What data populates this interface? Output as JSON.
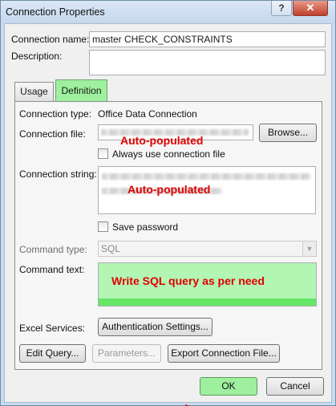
{
  "window": {
    "title": "Connection Properties",
    "help_glyph": "?",
    "close_glyph": "✕"
  },
  "connection": {
    "name_label": "Connection name:",
    "name_value": "master CHECK_CONSTRAINTS",
    "description_label": "Description:",
    "description_value": ""
  },
  "tabs": [
    {
      "label": "Usage",
      "selected": false
    },
    {
      "label": "Definition",
      "selected": true
    }
  ],
  "definition": {
    "connection_type_label": "Connection type:",
    "connection_type_value": "Office Data Connection",
    "connection_file_label": "Connection file:",
    "browse_label": "Browse...",
    "always_use_label": "Always use connection file",
    "connection_string_label": "Connection string:",
    "save_password_label": "Save password",
    "command_type_label": "Command type:",
    "command_type_value": "SQL",
    "command_text_label": "Command text:",
    "excel_services_label": "Excel Services:",
    "auth_settings_label": "Authentication Settings...",
    "edit_query_label": "Edit Query...",
    "parameters_label": "Parameters...",
    "export_label": "Export Connection File..."
  },
  "annotations": {
    "file_note": "Auto-populated",
    "string_note": "Auto-populated",
    "sql_note": "Write SQL query as per need",
    "annotation_color": "#e00000",
    "highlight_color": "#9ef09e"
  },
  "footer": {
    "ok_label": "OK",
    "cancel_label": "Cancel"
  }
}
